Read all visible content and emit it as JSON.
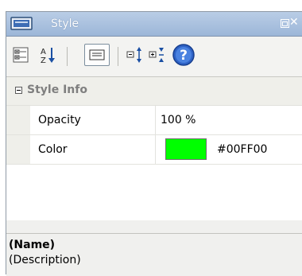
{
  "window": {
    "title": "Style"
  },
  "toolbar": {
    "buttons": [
      "categorized-view",
      "alphabetical-sort",
      "property-pages",
      "expand-all",
      "collapse-all",
      "help"
    ]
  },
  "grid": {
    "category": "Style Info",
    "properties": [
      {
        "name": "Opacity",
        "value": "100 %"
      },
      {
        "name": "Color",
        "value": "#00FF00",
        "swatch": "#00ff00"
      }
    ]
  },
  "help": {
    "name": "(Name)",
    "description": "(Description)"
  },
  "colors": {
    "titlebar": "#9cb6d8",
    "swatch": "#00ff00",
    "category_text": "#7f7f7f"
  }
}
